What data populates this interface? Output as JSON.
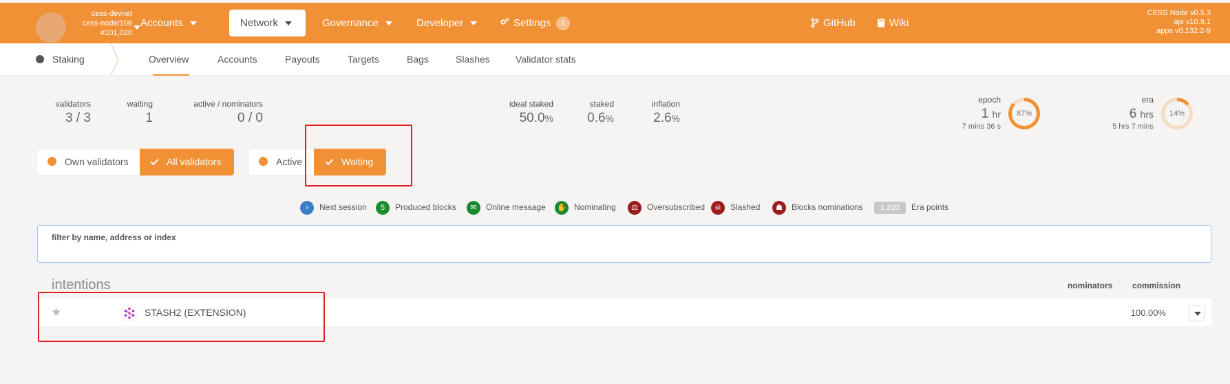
{
  "header": {
    "chain_name": "cess-devnet",
    "node_name": "cess-node/106",
    "block_number": "#101,020",
    "menu": [
      {
        "label": "Accounts"
      },
      {
        "label": "Network"
      },
      {
        "label": "Governance"
      },
      {
        "label": "Developer"
      },
      {
        "label": "Settings",
        "badge": "1"
      }
    ],
    "links": [
      {
        "label": "GitHub"
      },
      {
        "label": "Wiki"
      }
    ],
    "version": {
      "node": "CESS Node v0.5.3",
      "api": "api v10.9.1",
      "apps": "apps v0.132.2-9"
    }
  },
  "subnav": {
    "section": "Staking",
    "tabs": [
      "Overview",
      "Accounts",
      "Payouts",
      "Targets",
      "Bags",
      "Slashes",
      "Validator stats"
    ],
    "active_tab": "Overview"
  },
  "summary": {
    "validators": {
      "label": "validators",
      "value": "3 / 3"
    },
    "waiting": {
      "label": "waiting",
      "value": "1"
    },
    "active_nominators": {
      "label": "active / nominators",
      "value": "0 / 0"
    },
    "ideal_staked": {
      "label": "ideal staked",
      "value": "50.0",
      "unit": "%"
    },
    "staked": {
      "label": "staked",
      "value": "0.6",
      "unit": "%"
    },
    "inflation": {
      "label": "inflation",
      "value": "2.6",
      "unit": "%"
    },
    "epoch": {
      "label": "epoch",
      "value": "1",
      "unit": "hr",
      "sub": "7 mins 36 s",
      "progress_text": "87%",
      "progress": 0.87
    },
    "era": {
      "label": "era",
      "value": "6",
      "unit": "hrs",
      "sub": "5 hrs 7 mins",
      "progress_text": "14%",
      "progress": 0.14
    }
  },
  "filters": {
    "group1": {
      "off": "Own validators",
      "on": "All validators"
    },
    "group2": {
      "off": "Active",
      "on": "Waiting"
    }
  },
  "legend": [
    {
      "icon": "chevron-right-icon",
      "icon_text": "›",
      "color": "#3b80c4",
      "label": "Next session"
    },
    {
      "icon": "count-badge",
      "icon_text": "5",
      "color": "#1a8a2e",
      "label": "Produced blocks"
    },
    {
      "icon": "envelope-icon",
      "icon_text": "✉",
      "color": "#1a8a2e",
      "label": "Online message"
    },
    {
      "icon": "hand-icon",
      "icon_text": "✋",
      "color": "#1a8a2e",
      "label": "Nominating"
    },
    {
      "icon": "balance-scale-icon",
      "icon_text": "⚖",
      "color": "#9b1c1c",
      "label": "Oversubscribed"
    },
    {
      "icon": "skull-icon",
      "icon_text": "☠",
      "color": "#9b1c1c",
      "label": "Slashed"
    },
    {
      "icon": "user-slash-icon",
      "icon_text": "☗",
      "color": "#9b1c1c",
      "label": "Blocks nominations"
    },
    {
      "icon": "era-points-badge",
      "icon_text": "1,220",
      "color": "#c8c8c8",
      "label": "Era points"
    }
  ],
  "search": {
    "label": "filter by name, address or index"
  },
  "table": {
    "title": "intentions",
    "columns": [
      "nominators",
      "commission"
    ],
    "rows": [
      {
        "name": "STASH2 (EXTENSION)",
        "nominators": "",
        "commission": "100.00%"
      }
    ]
  },
  "colors": {
    "accent": "#f19135",
    "highlight": "#e02020"
  }
}
